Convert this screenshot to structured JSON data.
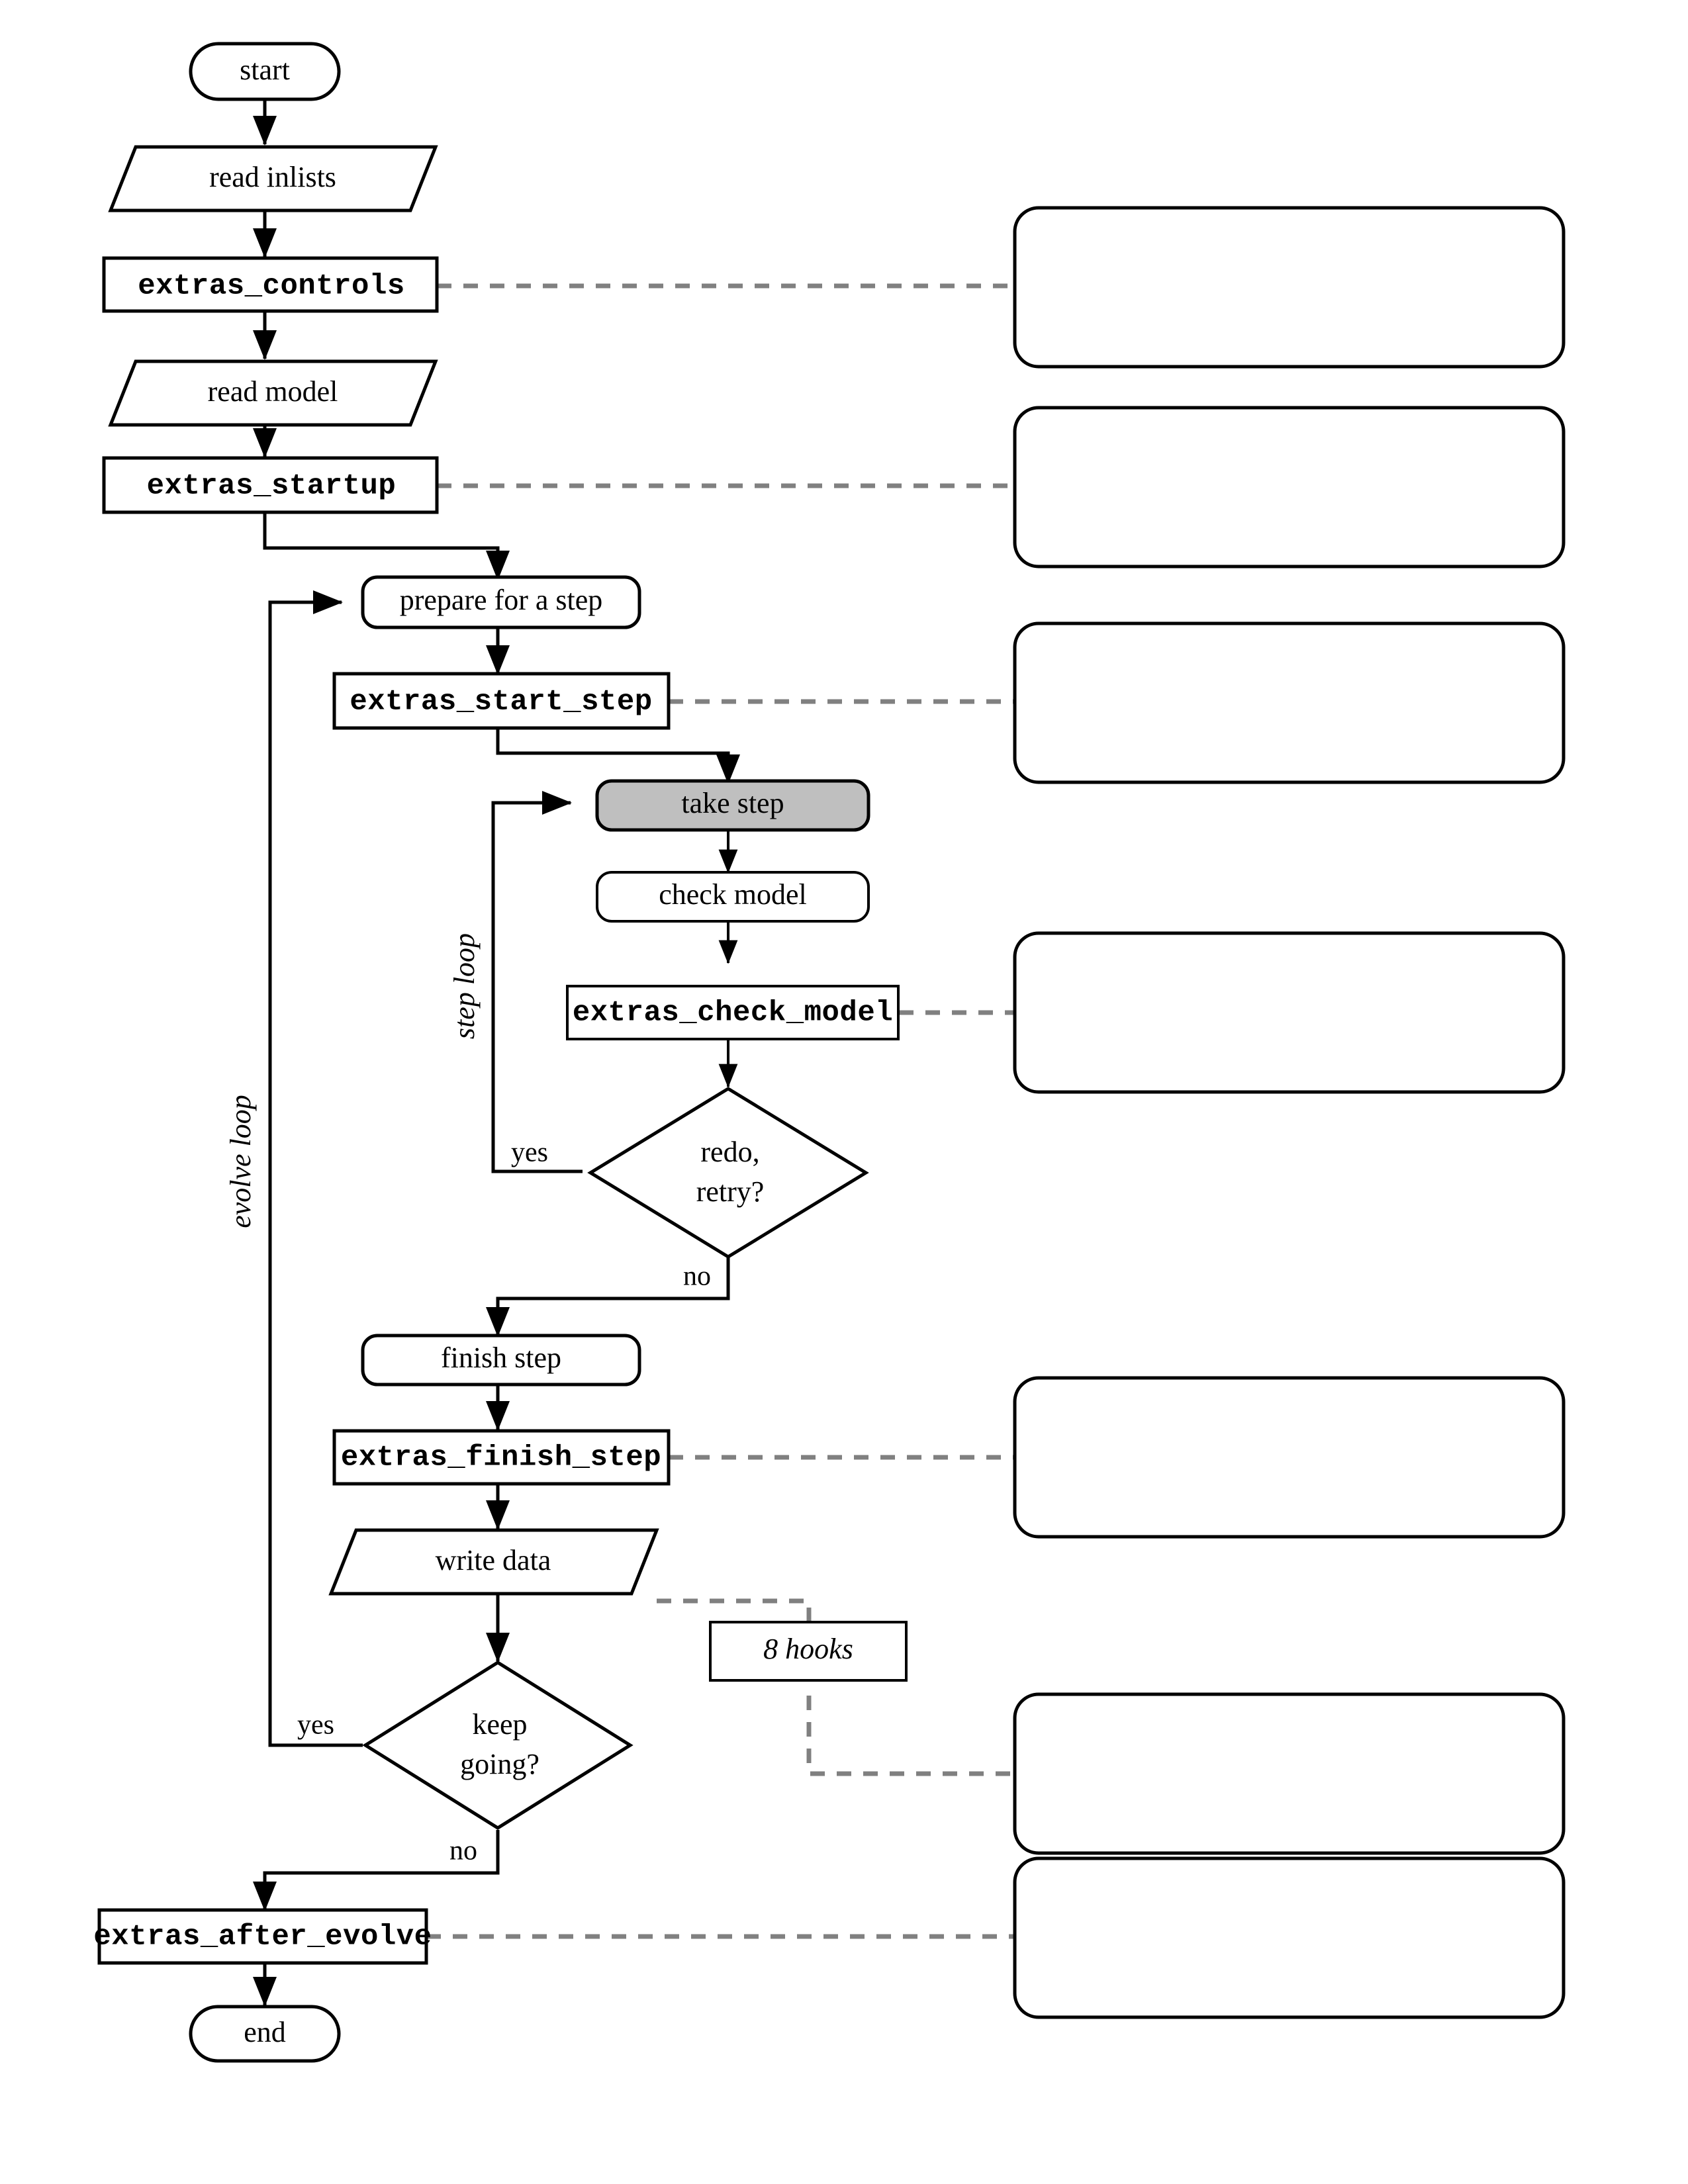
{
  "diagram": {
    "title": "MESA run_star evolution flowchart",
    "colors": {
      "shaded_node_fill": "#bfbfbf",
      "node_fill": "#ffffff",
      "stroke": "#000000",
      "dashed_connector": "#808080"
    }
  },
  "nodes": {
    "start": "start",
    "read_inlists": "read inlists",
    "extras_controls": "extras_controls",
    "read_model": "read model",
    "extras_startup": "extras_startup",
    "prepare_for_a_step": "prepare for a step",
    "extras_start_step": "extras_start_step",
    "take_step": "take step",
    "check_model": "check model",
    "extras_check_model": "extras_check_model",
    "redo_retry_line1": "redo,",
    "redo_retry_line2": "retry?",
    "finish_step": "finish step",
    "extras_finish_step": "extras_finish_step",
    "write_data": "write data",
    "keep_going_line1": "keep",
    "keep_going_line2": "going?",
    "extras_after_evolve": "extras_after_evolve",
    "end": "end",
    "hooks": "8 hooks"
  },
  "edge_labels": {
    "redo_yes": "yes",
    "redo_no": "no",
    "keep_going_yes": "yes",
    "keep_going_no": "no"
  },
  "loop_labels": {
    "step_loop": "step loop",
    "evolve_loop": "evolve loop"
  },
  "callouts": [
    {
      "id": "callout-extras-controls",
      "text": ""
    },
    {
      "id": "callout-extras-startup",
      "text": ""
    },
    {
      "id": "callout-extras-start-step",
      "text": ""
    },
    {
      "id": "callout-extras-check-model",
      "text": ""
    },
    {
      "id": "callout-extras-finish-step",
      "text": ""
    },
    {
      "id": "callout-hooks",
      "text": ""
    },
    {
      "id": "callout-extras-after-evolve",
      "text": ""
    }
  ]
}
